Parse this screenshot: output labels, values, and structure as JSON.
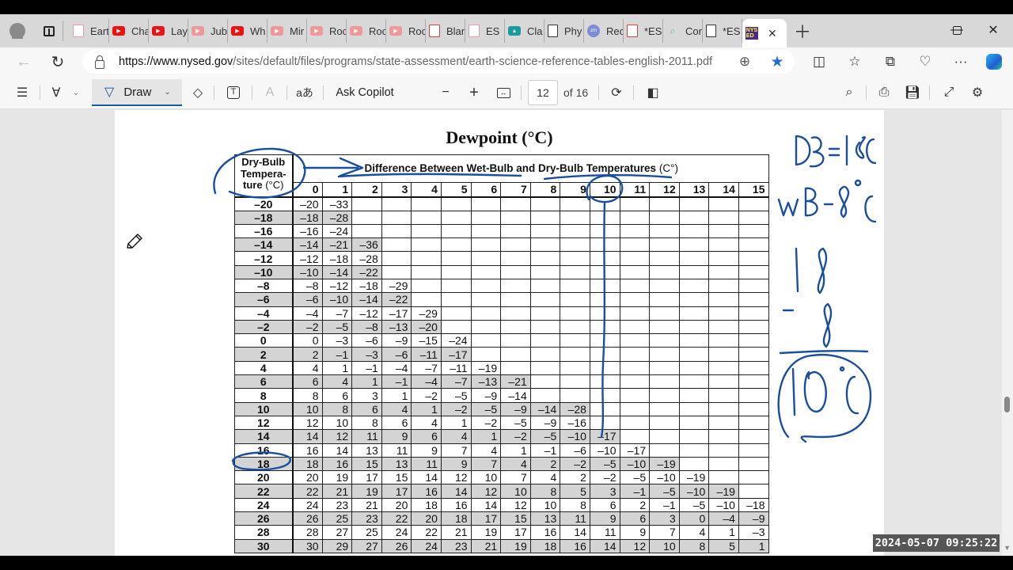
{
  "browser": {
    "tabs": [
      {
        "icon": "pdf-icon",
        "label": "Eart",
        "style": "pdfdim"
      },
      {
        "icon": "youtube-icon",
        "label": "Cha",
        "style": "yt"
      },
      {
        "icon": "youtube-icon",
        "label": "Lay",
        "style": "yt"
      },
      {
        "icon": "youtube-icon",
        "label": "Jub",
        "style": "ytdim"
      },
      {
        "icon": "youtube-icon",
        "label": "Wh",
        "style": "yt"
      },
      {
        "icon": "youtube-icon",
        "label": "Mir",
        "style": "ytdim"
      },
      {
        "icon": "youtube-icon",
        "label": "Roc",
        "style": "ytdim"
      },
      {
        "icon": "youtube-icon",
        "label": "Roc",
        "style": "ytdim"
      },
      {
        "icon": "youtube-icon",
        "label": "Roc",
        "style": "ytdim"
      },
      {
        "icon": "pdf-icon",
        "label": "Blar",
        "style": "pdf"
      },
      {
        "icon": "pdf-icon",
        "label": "ES",
        "style": "pdfdim"
      },
      {
        "icon": "classroom-icon",
        "label": "Cla",
        "style": "cls"
      },
      {
        "icon": "document-icon",
        "label": "Phy",
        "style": "doc"
      },
      {
        "icon": "zoom-icon",
        "label": "Rec",
        "style": "zm"
      },
      {
        "icon": "pdf-icon",
        "label": "*ES",
        "style": "pdf"
      },
      {
        "icon": "search-icon",
        "label": "Cor",
        "style": "srch"
      },
      {
        "icon": "document-icon",
        "label": "*ES",
        "style": "doc"
      }
    ],
    "active_tab": {
      "icon": "nysed-icon",
      "label": "NYS ED"
    },
    "url_host": "https://www.nysed.gov",
    "url_path": "/sites/default/files/programs/state-assessment/earth-science-reference-tables-english-2011.pdf"
  },
  "pdf_toolbar": {
    "draw_label": "Draw",
    "ask_copilot_label": "Ask Copilot",
    "current_page": "12",
    "page_count_label": "of 16",
    "read_aloud_label": "aあ"
  },
  "document": {
    "title": "Dewpoint (°C)",
    "corner_header": {
      "line1": "Dry-Bulb",
      "line2": "Tempera-",
      "line3": "ture",
      "unit": "(°C)"
    },
    "span_header": {
      "text": "Difference Between Wet-Bulb and Dry-Bulb Temperatures",
      "unit": "(C°)"
    },
    "columns": [
      "0",
      "1",
      "2",
      "3",
      "4",
      "5",
      "6",
      "7",
      "8",
      "9",
      "10",
      "11",
      "12",
      "13",
      "14",
      "15"
    ],
    "rows": [
      {
        "label": "–20",
        "values": [
          "–20",
          "–33"
        ]
      },
      {
        "label": "–18",
        "values": [
          "–18",
          "–28"
        ]
      },
      {
        "label": "–16",
        "values": [
          "–16",
          "–24"
        ]
      },
      {
        "label": "–14",
        "values": [
          "–14",
          "–21",
          "–36"
        ]
      },
      {
        "label": "–12",
        "values": [
          "–12",
          "–18",
          "–28"
        ]
      },
      {
        "label": "–10",
        "values": [
          "–10",
          "–14",
          "–22"
        ]
      },
      {
        "label": "–8",
        "values": [
          "–8",
          "–12",
          "–18",
          "–29"
        ]
      },
      {
        "label": "–6",
        "values": [
          "–6",
          "–10",
          "–14",
          "–22"
        ]
      },
      {
        "label": "–4",
        "values": [
          "–4",
          "–7",
          "–12",
          "–17",
          "–29"
        ]
      },
      {
        "label": "–2",
        "values": [
          "–2",
          "–5",
          "–8",
          "–13",
          "–20"
        ]
      },
      {
        "label": "0",
        "values": [
          "0",
          "–3",
          "–6",
          "–9",
          "–15",
          "–24"
        ]
      },
      {
        "label": "2",
        "values": [
          "2",
          "–1",
          "–3",
          "–6",
          "–11",
          "–17"
        ]
      },
      {
        "label": "4",
        "values": [
          "4",
          "1",
          "–1",
          "–4",
          "–7",
          "–11",
          "–19"
        ]
      },
      {
        "label": "6",
        "values": [
          "6",
          "4",
          "1",
          "–1",
          "–4",
          "–7",
          "–13",
          "–21"
        ]
      },
      {
        "label": "8",
        "values": [
          "8",
          "6",
          "3",
          "1",
          "–2",
          "–5",
          "–9",
          "–14"
        ]
      },
      {
        "label": "10",
        "values": [
          "10",
          "8",
          "6",
          "4",
          "1",
          "–2",
          "–5",
          "–9",
          "–14",
          "–28"
        ]
      },
      {
        "label": "12",
        "values": [
          "12",
          "10",
          "8",
          "6",
          "4",
          "1",
          "–2",
          "–5",
          "–9",
          "–16"
        ]
      },
      {
        "label": "14",
        "values": [
          "14",
          "12",
          "11",
          "9",
          "6",
          "4",
          "1",
          "–2",
          "–5",
          "–10",
          "–17"
        ]
      },
      {
        "label": "16",
        "values": [
          "16",
          "14",
          "13",
          "11",
          "9",
          "7",
          "4",
          "1",
          "–1",
          "–6",
          "–10",
          "–17"
        ]
      },
      {
        "label": "18",
        "values": [
          "18",
          "16",
          "15",
          "13",
          "11",
          "9",
          "7",
          "4",
          "2",
          "–2",
          "–5",
          "–10",
          "–19"
        ]
      },
      {
        "label": "20",
        "values": [
          "20",
          "19",
          "17",
          "15",
          "14",
          "12",
          "10",
          "7",
          "4",
          "2",
          "–2",
          "–5",
          "–10",
          "–19"
        ]
      },
      {
        "label": "22",
        "values": [
          "22",
          "21",
          "19",
          "17",
          "16",
          "14",
          "12",
          "10",
          "8",
          "5",
          "3",
          "–1",
          "–5",
          "–10",
          "–19"
        ]
      },
      {
        "label": "24",
        "values": [
          "24",
          "23",
          "21",
          "20",
          "18",
          "16",
          "14",
          "12",
          "10",
          "8",
          "6",
          "2",
          "–1",
          "–5",
          "–10",
          "–18"
        ]
      },
      {
        "label": "26",
        "values": [
          "26",
          "25",
          "23",
          "22",
          "20",
          "18",
          "17",
          "15",
          "13",
          "11",
          "9",
          "6",
          "3",
          "0",
          "–4",
          "–9"
        ]
      },
      {
        "label": "28",
        "values": [
          "28",
          "27",
          "25",
          "24",
          "22",
          "21",
          "19",
          "17",
          "16",
          "14",
          "11",
          "9",
          "7",
          "4",
          "1",
          "–3"
        ]
      },
      {
        "label": "30",
        "values": [
          "30",
          "29",
          "27",
          "26",
          "24",
          "23",
          "21",
          "19",
          "18",
          "16",
          "14",
          "12",
          "10",
          "8",
          "5",
          "1"
        ]
      }
    ]
  },
  "annotations": {
    "handwritten": [
      "DB=18°C",
      "WB=8°C",
      "18",
      "−8",
      "10°C"
    ],
    "ink_color": "#1a4fa0"
  },
  "overlay": {
    "timestamp": "2024-05-07 09:25:22"
  }
}
